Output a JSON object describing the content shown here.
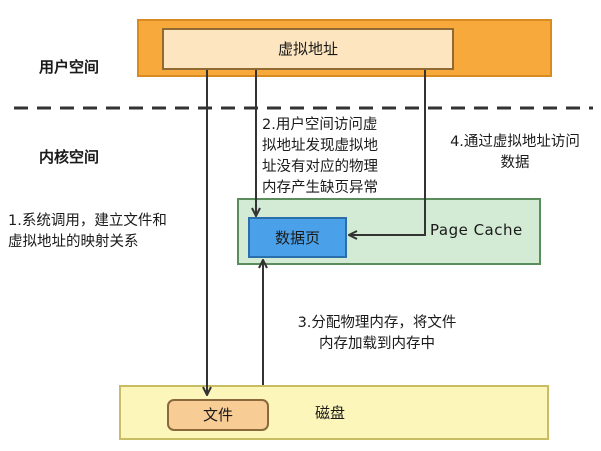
{
  "regions": {
    "user_space": "用户空间",
    "kernel_space": "内核空间"
  },
  "boxes": {
    "virtual_address": "虚拟地址",
    "page_cache": "Page Cache",
    "data_page": "数据页",
    "disk": "磁盘",
    "file": "文件"
  },
  "annotations": {
    "step1": [
      "1.系统调用，建立文件和",
      "虚拟地址的映射关系"
    ],
    "step2": [
      "2.用户空间访问虚",
      "拟地址发现虚拟地",
      "址没有对应的物理",
      "内存产生缺页异常"
    ],
    "step3": [
      "3.分配物理内存，将文件",
      "内存加载到内存中"
    ],
    "step4": [
      "4.通过虚拟地址访问",
      "数据"
    ]
  },
  "colors": {
    "user_space_fill": "#f7a93b",
    "virtual_address_fill": "#fde5bf",
    "page_cache_fill": "#d3ead4",
    "data_page_fill": "#4aa0e9",
    "disk_fill": "#fcf6ba",
    "file_fill": "#f7cd95",
    "arrow": "#333333"
  }
}
